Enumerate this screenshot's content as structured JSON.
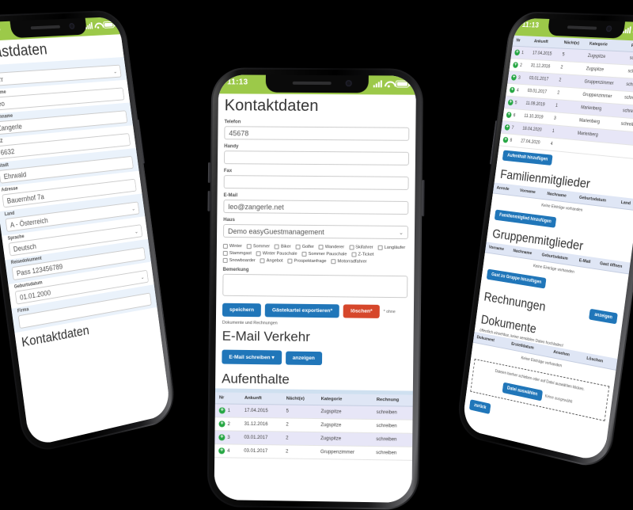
{
  "status_bar": {
    "time": "11:13",
    "signal_icon": "signal-bars-icon",
    "wifi_icon": "wifi-icon",
    "battery_icon": "battery-icon"
  },
  "colors": {
    "status_green": "#9cc949",
    "primary_blue": "#2076b9",
    "danger_red": "#d6472b",
    "row_alt": "#e7e6f7",
    "header_row": "#dfe6f5",
    "zebra_field": "#eaf2fb"
  },
  "phone_left": {
    "title": "Gastdaten",
    "fields": [
      {
        "label": "Anrede",
        "value": "Herr",
        "type": "select"
      },
      {
        "label": "Vorname",
        "value": "Leo",
        "type": "text"
      },
      {
        "label": "Nachname",
        "value": "Zangerle",
        "type": "text"
      },
      {
        "label": "PLZ",
        "value": "6632",
        "type": "text"
      },
      {
        "label": "Stadt",
        "value": "Ehrwald",
        "type": "text"
      },
      {
        "label": "Adresse",
        "value": "Bauernhof 7a",
        "type": "text"
      },
      {
        "label": "Land",
        "value": "A - Österreich",
        "type": "select"
      },
      {
        "label": "Sprache",
        "value": "Deutsch",
        "type": "select"
      },
      {
        "label": "Reisedokument",
        "value": "Pass  123456789",
        "type": "text"
      },
      {
        "label": "Geburtsdatum",
        "value": "01.01.2000",
        "type": "date"
      },
      {
        "label": "Firma",
        "value": "",
        "type": "text"
      }
    ],
    "next_section_title": "Kontaktdaten"
  },
  "phone_center": {
    "title": "Kontaktdaten",
    "fields": [
      {
        "label": "Telefon",
        "value": "45678",
        "type": "text"
      },
      {
        "label": "Handy",
        "value": "",
        "type": "text"
      },
      {
        "label": "Fax",
        "value": "",
        "type": "text"
      },
      {
        "label": "E-Mail",
        "value": "leo@zangerle.net",
        "type": "text"
      },
      {
        "label": "Haus",
        "value": "Demo easyGuestmanagement",
        "type": "select"
      }
    ],
    "checkboxes": [
      "Winter",
      "Sommer",
      "Biker",
      "Golfer",
      "Wanderer",
      "Skifahrer",
      "Langläufer",
      "Stammgast",
      "Winter Pauschale",
      "Sommer Pauschale",
      "Z-Ticket",
      "Snowboarder",
      "Angebot",
      "Prospektanfrage",
      "Motorradfahrer"
    ],
    "remark_label": "Bemerkung",
    "remark_value": "",
    "buttons": {
      "save": "speichern",
      "export": "Gästekartei exportieren*",
      "delete": "löschen*"
    },
    "footnote": "* ohne",
    "footnote_2": "Dokumente und Rechnungen",
    "email_section_title": "E-Mail Verkehr",
    "email_buttons": {
      "write": "E-Mail schreiben",
      "show": "anzeigen"
    },
    "stays_title": "Aufenthalte",
    "stays_table": {
      "columns": [
        "Nr",
        "Ankunft",
        "Nächt(e)",
        "Kategorie",
        "Rechnung"
      ],
      "rows": [
        {
          "nr": "1",
          "ankunft": "17.04.2015",
          "naechte": "5",
          "kategorie": "Zugspitze",
          "rechnung": "schreiben"
        },
        {
          "nr": "2",
          "ankunft": "31.12.2016",
          "naechte": "2",
          "kategorie": "Zugspitze",
          "rechnung": "schreiben"
        },
        {
          "nr": "3",
          "ankunft": "03.01.2017",
          "naechte": "2",
          "kategorie": "Zugspitze",
          "rechnung": "schreiben"
        },
        {
          "nr": "4",
          "ankunft": "03.01.2017",
          "naechte": "2",
          "kategorie": "Gruppenzimmer",
          "rechnung": "schreiben"
        }
      ]
    }
  },
  "phone_right": {
    "stays_table": {
      "columns": [
        "Nr",
        "Ankunft",
        "Nächt(e)",
        "Kategorie",
        "Rechnung"
      ],
      "rows": [
        {
          "nr": "1",
          "ankunft": "17.04.2015",
          "naechte": "5",
          "kategorie": "Zugspitze",
          "rechnung": "schreiben"
        },
        {
          "nr": "2",
          "ankunft": "31.12.2016",
          "naechte": "2",
          "kategorie": "Zugspitze",
          "rechnung": "schreiben"
        },
        {
          "nr": "3",
          "ankunft": "03.01.2017",
          "naechte": "2",
          "kategorie": "Gruppenzimmer",
          "rechnung": "schreiben"
        },
        {
          "nr": "4",
          "ankunft": "03.01.2017",
          "naechte": "2",
          "kategorie": "Gruppenzimmer",
          "rechnung": "schreiben"
        },
        {
          "nr": "5",
          "ankunft": "11.09.2019",
          "naechte": "1",
          "kategorie": "Marienberg",
          "rechnung": "schreiben"
        },
        {
          "nr": "6",
          "ankunft": "11.10.2019",
          "naechte": "3",
          "kategorie": "Marienberg",
          "rechnung": "schreiben"
        },
        {
          "nr": "7",
          "ankunft": "18.04.2020",
          "naechte": "1",
          "kategorie": "Marienberg",
          "rechnung": ""
        },
        {
          "nr": "8",
          "ankunft": "27.04.2020",
          "naechte": "4",
          "kategorie": "",
          "rechnung": ""
        }
      ]
    },
    "add_stay_button": "Aufenthalt hinzufügen",
    "family_section": {
      "title": "Familienmitglieder",
      "columns": [
        "Anrede",
        "Vorname",
        "Nachname",
        "Geburtsdatum",
        "Land"
      ],
      "empty_text": "Keine Einträge vorhanden",
      "add_button": "Familienmitglied hinzufügen"
    },
    "group_section": {
      "title": "Gruppenmitglieder",
      "columns": [
        "Vorname",
        "Nachname",
        "Geburtsdatum",
        "E-Mail",
        "Gast öffnen"
      ],
      "empty_text": "Keine Einträge vorhanden",
      "add_button": "Gast zu Gruppe hinzufügen"
    },
    "invoices_section": {
      "title": "Rechnungen",
      "show_button": "anzeigen"
    },
    "documents_section": {
      "title": "Dokumente",
      "hint": "öffentlich einsehbar, keine sensiblen Daten hochladen!",
      "columns": [
        "Dokument",
        "Erstelldatum",
        "Ansehen",
        "Löschen"
      ],
      "empty_text": "Keine Einträge vorhanden",
      "drop_text": "Dateien hierher schieben oder auf Datei auswählen klicken.",
      "file_button": "Datei auswählen",
      "file_status": "Keine ausgewählt"
    },
    "back_button": "zurück"
  }
}
